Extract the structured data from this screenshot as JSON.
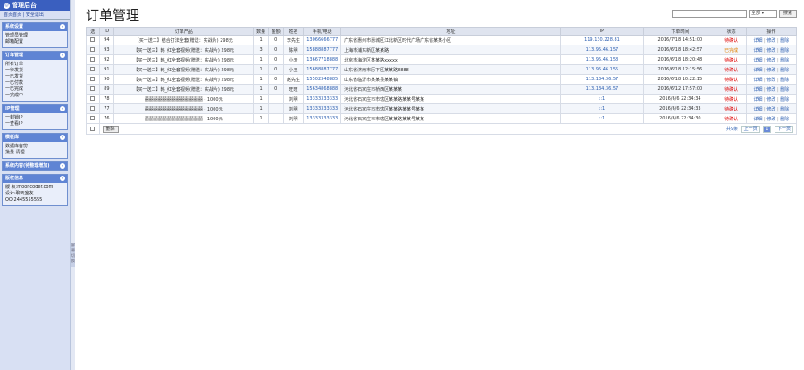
{
  "sidebar": {
    "title": "管理后台",
    "links": "首页首页 | 安全退出",
    "sections": [
      {
        "title": "系统设置",
        "items": [
          "管理员管理",
          "邮箱配置"
        ]
      },
      {
        "title": "订单管理",
        "items": [
          "所有订单",
          "一待发货",
          "一已发货",
          "一已付款",
          "一已完成",
          "一完成中"
        ]
      },
      {
        "title": "IP管理",
        "items": [
          "一封锁IP",
          "一查看IP"
        ]
      },
      {
        "title": "模板库",
        "items": [
          "数据库备份",
          "批量·清理"
        ]
      },
      {
        "title": "系统内容(待整理增加)",
        "items": []
      },
      {
        "title": "版权信息",
        "items": [
          "版 权:mooncoder.com",
          "设计:聊天室友",
          "QQ:2445555555"
        ]
      }
    ]
  },
  "main": {
    "title": "订单管理",
    "search": {
      "select": "全部",
      "button": "搜索"
    },
    "columns": [
      "选",
      "ID",
      "订单产品",
      "数量",
      "金额",
      "姓名",
      "手机/电话",
      "地址",
      "IP",
      "下单时间",
      "状态",
      "操作"
    ],
    "rows": [
      {
        "id": "94",
        "product": "【买一送二】结合打法全套(赠送：实战片) 298元",
        "qty": "1",
        "amt": "0",
        "name": "李先生",
        "phone": "13066666777",
        "addr": "广东省惠州市惠城区江北新区时代广场广东省某某小区",
        "ip": "119.130.228.81",
        "time": "2016/7/18 14:51:00",
        "status": "待确认",
        "status_color": "red"
      },
      {
        "id": "93",
        "product": "【买一送三】韩_红全套视频(赠送：实战片) 298元",
        "qty": "3",
        "amt": "0",
        "name": "陈明",
        "phone": "15888887777",
        "addr": "上海市浦东新区某某路",
        "ip": "113.95.46.157",
        "time": "2016/6/18 18:42:57",
        "status": "已完成",
        "status_color": "orange"
      },
      {
        "id": "92",
        "product": "【买一送三】韩_红全套视频(赠送：实战片) 298元",
        "qty": "1",
        "amt": "0",
        "name": "小天",
        "phone": "13667718888",
        "addr": "北京市海淀区某某路xxxxx",
        "ip": "113.95.46.158",
        "time": "2016/6/18 18:20:48",
        "status": "待确认",
        "status_color": "red"
      },
      {
        "id": "91",
        "product": "【买一送三】韩_红全套视频(赠送：实战片) 298元",
        "qty": "1",
        "amt": "0",
        "name": "小王",
        "phone": "15688887777",
        "addr": "山东省济南市历下区某某路8888",
        "ip": "113.95.46.155",
        "time": "2016/6/18 12:15:56",
        "status": "待确认",
        "status_color": "red"
      },
      {
        "id": "90",
        "product": "【买一送三】韩_红全套视频(赠送：实战片) 298元",
        "qty": "1",
        "amt": "0",
        "name": "赵先生",
        "phone": "15502348885",
        "addr": "山东省临沂市某某县某某镇",
        "ip": "113.134.36.57",
        "time": "2016/6/18 10:22:15",
        "status": "待确认",
        "status_color": "red"
      },
      {
        "id": "89",
        "product": "【买一送二】韩_红全套视频(赠送：实战片) 298元",
        "qty": "1",
        "amt": "0",
        "name": "旺旺",
        "phone": "15634868888",
        "addr": "河北省石家庄市桥西区某某某",
        "ip": "113.134.36.57",
        "time": "2016/6/12 17:57:00",
        "status": "待确认",
        "status_color": "red"
      },
      {
        "id": "78",
        "product": "囍囍囍囍囍囍囍囍囍囍囍囍囍 - 1000元",
        "qty": "1",
        "amt": "",
        "name": "刘明",
        "phone": "13333333333",
        "addr": "河北省石家庄市市辖区某某路某某号某某",
        "ip": "::1",
        "time": "2016/6/6 22:34:34",
        "status": "待确认",
        "status_color": "red"
      },
      {
        "id": "77",
        "product": "囍囍囍囍囍囍囍囍囍囍囍囍囍 - 1000元",
        "qty": "1",
        "amt": "",
        "name": "刘明",
        "phone": "13333333333",
        "addr": "河北省石家庄市市辖区某某路某某号某某",
        "ip": "::1",
        "time": "2016/6/6 22:34:33",
        "status": "待确认",
        "status_color": "red"
      },
      {
        "id": "76",
        "product": "囍囍囍囍囍囍囍囍囍囍囍囍囍 - 1000元",
        "qty": "1",
        "amt": "",
        "name": "刘明",
        "phone": "13333333333",
        "addr": "河北省石家庄市市辖区某某路某某号某某",
        "ip": "::1",
        "time": "2016/6/6 22:34:30",
        "status": "待确认",
        "status_color": "red"
      }
    ],
    "actions": [
      "详细",
      "修改",
      "删除"
    ],
    "footer": {
      "delete": "删除",
      "total": "共9条",
      "prev": "上一页",
      "page": "1",
      "next": "下一页"
    }
  },
  "colors": {
    "accent": "#3a5fbf",
    "section": "#5f84d4",
    "danger": "#dd0000",
    "warn": "#e08000"
  }
}
